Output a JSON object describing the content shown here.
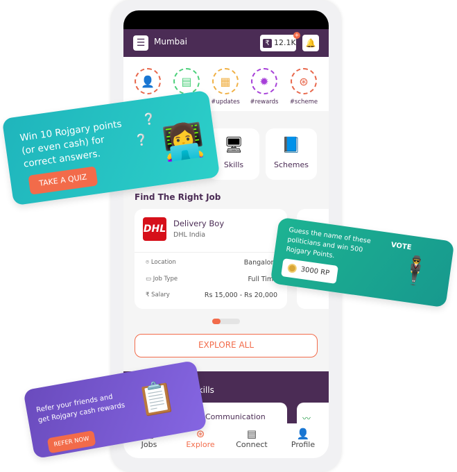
{
  "header": {
    "city": "Mumbai",
    "points": "12.1K",
    "points_badge": "+"
  },
  "categories": [
    {
      "label": "",
      "icon": "person-laptop-icon",
      "color": "#e8664a"
    },
    {
      "label": "",
      "icon": "documents-icon",
      "color": "#4bd07a"
    },
    {
      "label": "#updates",
      "icon": "news-icon",
      "color": "#f0b044"
    },
    {
      "label": "#rewards",
      "icon": "badge-icon",
      "color": "#a63ed8"
    },
    {
      "label": "#scheme",
      "icon": "scheme-icon",
      "color": "#e8664a"
    }
  ],
  "tiles": [
    {
      "label": "Skills",
      "icon": "monitor-icon"
    },
    {
      "label": "Schemes",
      "icon": "folder-icon"
    }
  ],
  "jobs_section": {
    "title": "Find The Right Job"
  },
  "job": {
    "title": "Delivery Boy",
    "company": "DHL India",
    "logo_text": "DHL",
    "rows": [
      {
        "key": "Location",
        "value": "Bangalore",
        "icon": "location-pin-icon"
      },
      {
        "key": "Job Type",
        "value": "Full Time",
        "icon": "briefcase-icon"
      },
      {
        "key": "Salary",
        "value": "Rs 15,000 - Rs 20,000",
        "icon": "rupee-icon"
      }
    ]
  },
  "explore_all": "EXPLORE ALL",
  "skills_section": {
    "title": "Skills",
    "card": "Communication"
  },
  "nav": [
    {
      "label": "Jobs",
      "icon": "jobs-icon"
    },
    {
      "label": "Explore",
      "icon": "explore-icon",
      "active": true
    },
    {
      "label": "Connect",
      "icon": "chat-icon"
    },
    {
      "label": "Profile",
      "icon": "profile-icon"
    }
  ],
  "promos": {
    "quiz": {
      "text": "Win 10 Rojgary points (or even cash) for correct answers.",
      "button": "TAKE A QUIZ"
    },
    "vote": {
      "text": "Guess the name of these politicians and win 500 Rojgary Points.",
      "points": "3000 RP",
      "illustration_text": "VOTE"
    },
    "refer": {
      "text": "Refer your friends and get Rojgary cash rewards",
      "button": "REFER NOW"
    }
  },
  "colors": {
    "brand": "#4b2c55",
    "accent": "#f26b4a"
  }
}
